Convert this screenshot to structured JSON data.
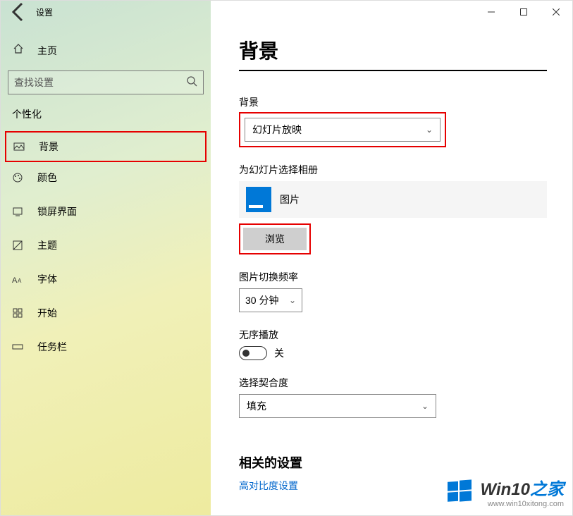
{
  "app": {
    "title": "设置"
  },
  "sidebar": {
    "home": "主页",
    "search_placeholder": "查找设置",
    "section": "个性化",
    "items": [
      {
        "label": "背景"
      },
      {
        "label": "颜色"
      },
      {
        "label": "锁屏界面"
      },
      {
        "label": "主题"
      },
      {
        "label": "字体"
      },
      {
        "label": "开始"
      },
      {
        "label": "任务栏"
      }
    ]
  },
  "main": {
    "title": "背景",
    "bg_label": "背景",
    "bg_value": "幻灯片放映",
    "album_label": "为幻灯片选择相册",
    "album_name": "图片",
    "browse": "浏览",
    "interval_label": "图片切换频率",
    "interval_value": "30 分钟",
    "shuffle_label": "无序播放",
    "shuffle_state": "关",
    "fit_label": "选择契合度",
    "fit_value": "填充",
    "related_title": "相关的设置",
    "related_link": "高对比度设置"
  },
  "watermark": {
    "brand_prefix": "Win10",
    "brand_suffix": "之家",
    "url": "www.win10xitong.com"
  }
}
